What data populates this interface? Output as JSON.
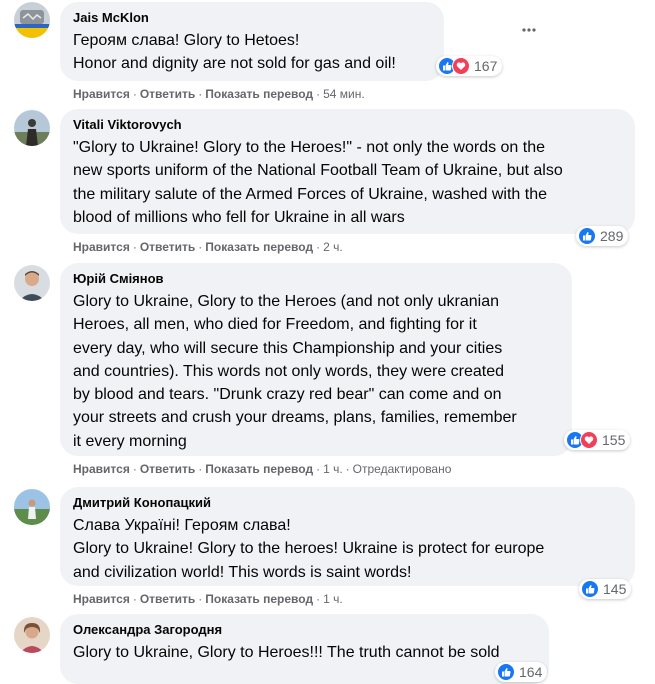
{
  "actions": {
    "like": "Нравится",
    "reply": "Ответить",
    "translate": "Показать перевод",
    "sep": "·"
  },
  "colors": {
    "bubble": "#f0f2f5",
    "like": "#1877f2",
    "love": "#f33e58",
    "meta": "#65676b"
  },
  "comments": [
    {
      "author": "Jais McKlon",
      "lines": [
        "Героям слава! Glory to Hetoes!",
        "Honor and dignity are not sold for gas and oil!"
      ],
      "time": "54 мин.",
      "reactions": [
        "like",
        "love"
      ],
      "count": "167"
    },
    {
      "author": "Vitali Viktorovych",
      "lines": [
        "\"Glory to Ukraine! Glory to the Heroes!\" - not only the words on the",
        "new sports uniform of the National Football Team of Ukraine, but also",
        "the military salute of the Armed Forces of Ukraine, washed with the",
        "blood of millions who fell for Ukraine in all wars"
      ],
      "time": "2 ч.",
      "reactions": [
        "like"
      ],
      "count": "289"
    },
    {
      "author": "Юрій Сміянов",
      "lines": [
        "Glory to Ukraine, Glory to the Heroes (and not only ukranian",
        "Heroes, all men, who died for Freedom, and fighting for it",
        "every day, who will secure this Championship and your cities",
        "and countries). This words not only words, they were created",
        "by blood and tears. \"Drunk crazy red bear\" can come and on",
        "your streets and crush your dreams, plans, families, remember",
        "it every morning"
      ],
      "time": "1 ч.",
      "edited": "Отредактировано",
      "reactions": [
        "like",
        "love"
      ],
      "count": "155"
    },
    {
      "author": "Дмитрий Конопацкий",
      "lines": [
        "Слава Україні! Героям слава!",
        "Glory to Ukraine! Glory to the heroes! Ukraine is protect for europe",
        "and civilization world! This words is saint words!"
      ],
      "time": "1 ч.",
      "reactions": [
        "like"
      ],
      "count": "145"
    },
    {
      "author": "Олександра Загородня",
      "lines": [
        "Glory to Ukraine, Glory to Heroes!!! The truth cannot be sold"
      ],
      "time": "",
      "reactions": [
        "like"
      ],
      "count": "164"
    }
  ],
  "icons": {
    "more": "more-horizontal-icon",
    "like": "thumbs-up-icon",
    "love": "heart-icon"
  }
}
